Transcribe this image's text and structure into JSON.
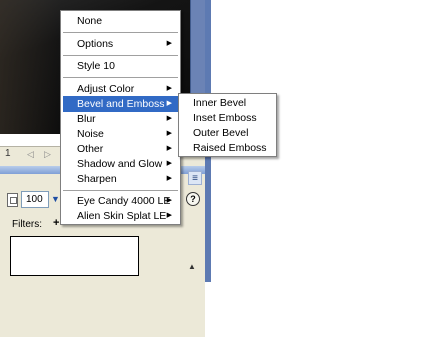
{
  "timeline": {
    "frame": "1"
  },
  "properties": {
    "opacity_value": "100",
    "filters_label": "Filters:",
    "add_filter": "+"
  },
  "icons": {
    "prev": "◁",
    "next": "▷",
    "dropdown": "▼",
    "help": "?",
    "options": "≡",
    "collapse": "▲",
    "submenu_arrow": "▶"
  },
  "menu": {
    "items": [
      {
        "label": "None",
        "has_sub": false
      },
      {
        "label": "Options",
        "has_sub": true
      },
      {
        "label": "Style 10",
        "has_sub": false
      },
      {
        "label": "Adjust Color",
        "has_sub": true
      },
      {
        "label": "Bevel and Emboss",
        "has_sub": true,
        "highlighted": true
      },
      {
        "label": "Blur",
        "has_sub": true
      },
      {
        "label": "Noise",
        "has_sub": true
      },
      {
        "label": "Other",
        "has_sub": true
      },
      {
        "label": "Shadow and Glow",
        "has_sub": true
      },
      {
        "label": "Sharpen",
        "has_sub": true
      },
      {
        "label": "Eye Candy 4000 LE",
        "has_sub": true
      },
      {
        "label": "Alien Skin Splat LE",
        "has_sub": true
      }
    ]
  },
  "submenu": {
    "items": [
      "Inner Bevel",
      "Inset Emboss",
      "Outer Bevel",
      "Raised Emboss"
    ]
  },
  "colors": {
    "highlight": "#316ac5",
    "panel_bg": "#ece9d8",
    "side_blue": "#5d7ab2"
  }
}
